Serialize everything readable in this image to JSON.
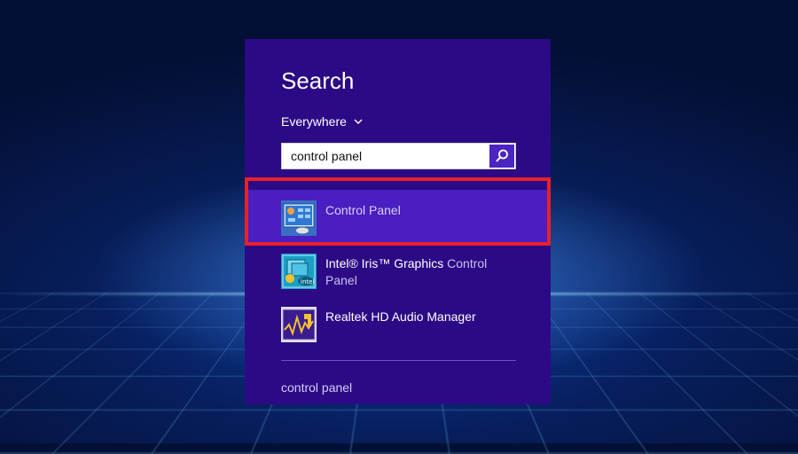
{
  "search": {
    "title": "Search",
    "scope_label": "Everywhere",
    "query": "control panel"
  },
  "results": [
    {
      "label": "Control Panel",
      "icon": "control-panel-icon",
      "selected": true
    },
    {
      "label_main": "Intel® Iris™ Graphics",
      "label_dim": "Control Panel",
      "icon": "intel-graphics-icon"
    },
    {
      "label": "Realtek HD Audio Manager",
      "icon": "realtek-audio-icon"
    }
  ],
  "footer": {
    "query_suggestion": "control panel"
  },
  "colors": {
    "panel_bg": "#2c0a86",
    "selected_bg": "#4a1ec0",
    "search_button": "#4b24c2",
    "highlight_border": "#e8202a"
  }
}
